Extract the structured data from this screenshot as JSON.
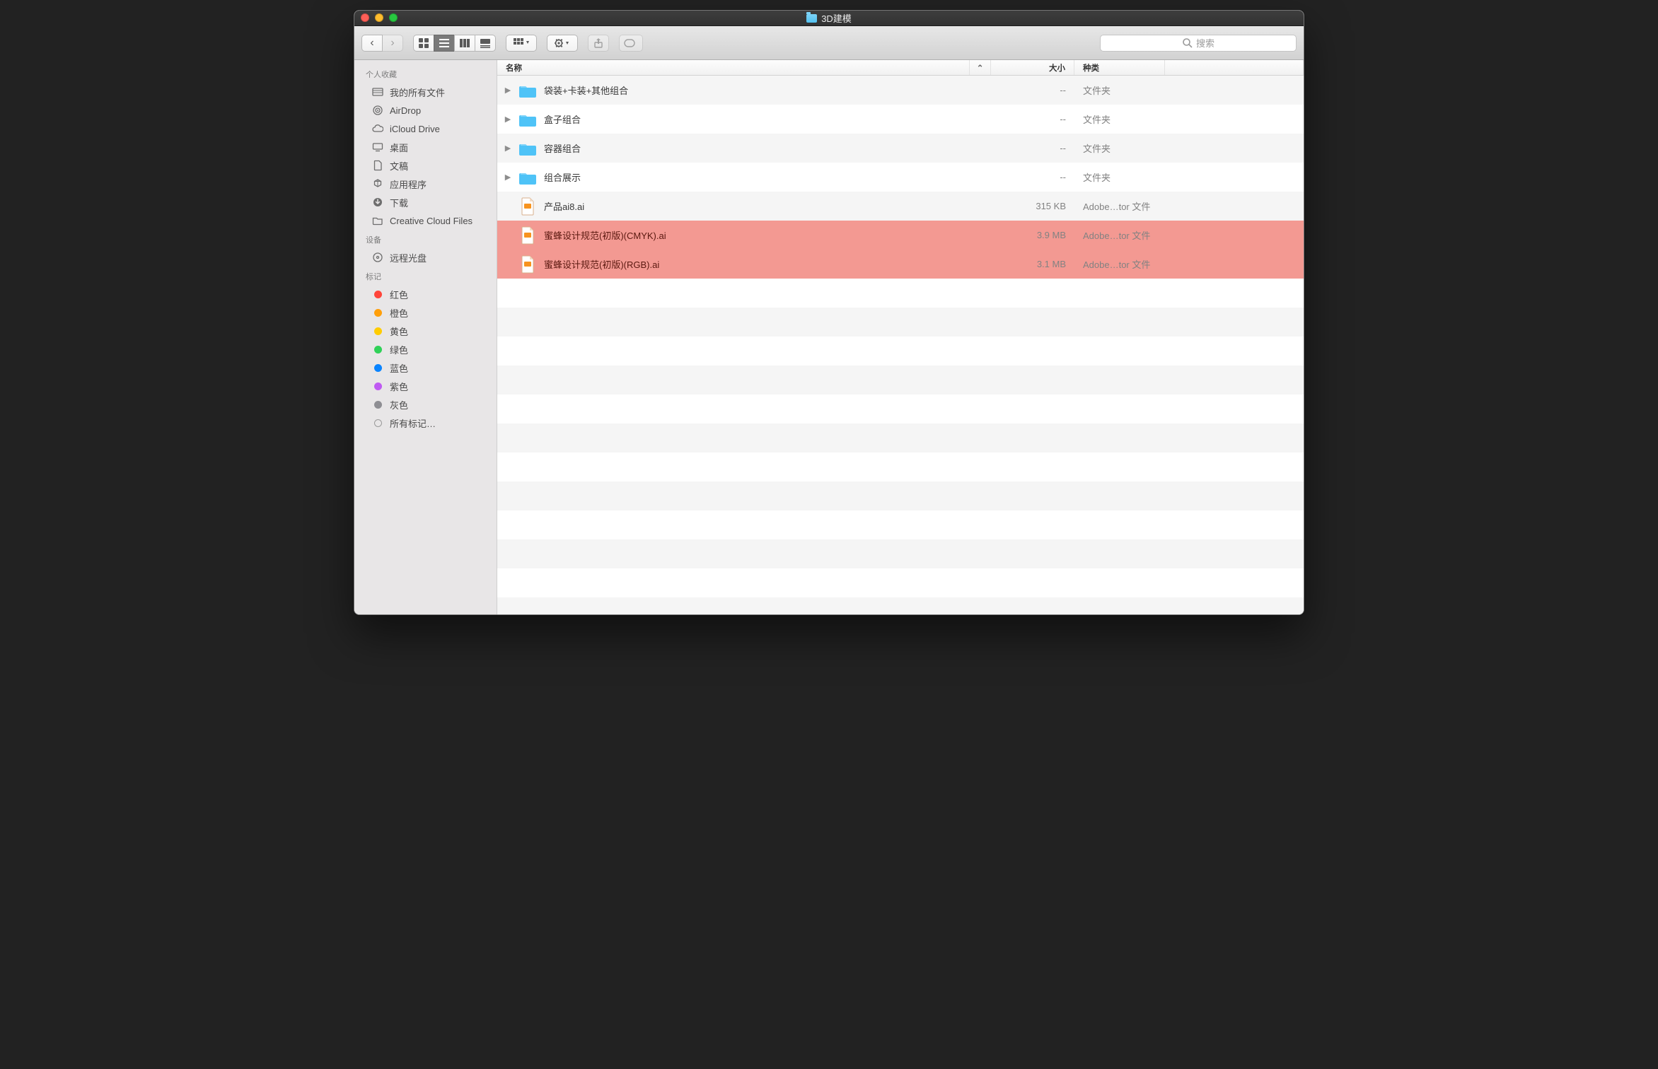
{
  "window": {
    "title": "3D建模"
  },
  "search": {
    "placeholder": "搜索"
  },
  "sidebar": {
    "sections": [
      {
        "heading": "个人收藏",
        "items": [
          {
            "icon": "all-files",
            "label": "我的所有文件"
          },
          {
            "icon": "airdrop",
            "label": "AirDrop"
          },
          {
            "icon": "icloud",
            "label": "iCloud Drive"
          },
          {
            "icon": "desktop",
            "label": "桌面"
          },
          {
            "icon": "documents",
            "label": "文稿"
          },
          {
            "icon": "applications",
            "label": "应用程序"
          },
          {
            "icon": "downloads",
            "label": "下载"
          },
          {
            "icon": "folder",
            "label": "Creative Cloud Files"
          }
        ]
      },
      {
        "heading": "设备",
        "items": [
          {
            "icon": "disc",
            "label": "远程光盘"
          }
        ]
      },
      {
        "heading": "标记",
        "items": [
          {
            "icon": "tag",
            "color": "red",
            "label": "红色"
          },
          {
            "icon": "tag",
            "color": "orange",
            "label": "橙色"
          },
          {
            "icon": "tag",
            "color": "yellow",
            "label": "黄色"
          },
          {
            "icon": "tag",
            "color": "green",
            "label": "绿色"
          },
          {
            "icon": "tag",
            "color": "blue",
            "label": "蓝色"
          },
          {
            "icon": "tag",
            "color": "purple",
            "label": "紫色"
          },
          {
            "icon": "tag",
            "color": "gray",
            "label": "灰色"
          },
          {
            "icon": "tag",
            "color": "outline",
            "label": "所有标记…"
          }
        ]
      }
    ]
  },
  "columns": {
    "name": "名称",
    "size": "大小",
    "kind": "种类"
  },
  "files": [
    {
      "type": "folder",
      "name": "袋装+卡装+其他组合",
      "size": "--",
      "kind": "文件夹",
      "disclosure": true
    },
    {
      "type": "folder",
      "name": "盒子组合",
      "size": "--",
      "kind": "文件夹",
      "disclosure": true
    },
    {
      "type": "folder",
      "name": "容器组合",
      "size": "--",
      "kind": "文件夹",
      "disclosure": true
    },
    {
      "type": "folder",
      "name": "组合展示",
      "size": "--",
      "kind": "文件夹",
      "disclosure": true
    },
    {
      "type": "ai",
      "name": "产品ai8.ai",
      "size": "315 KB",
      "kind": "Adobe…tor 文件",
      "disclosure": false
    },
    {
      "type": "ai",
      "name": "蜜蜂设计规范(初版)(CMYK).ai",
      "size": "3.9 MB",
      "kind": "Adobe…tor 文件",
      "disclosure": false,
      "highlight": true
    },
    {
      "type": "ai",
      "name": "蜜蜂设计规范(初版)(RGB).ai",
      "size": "3.1 MB",
      "kind": "Adobe…tor 文件",
      "disclosure": false,
      "highlight": true
    }
  ]
}
